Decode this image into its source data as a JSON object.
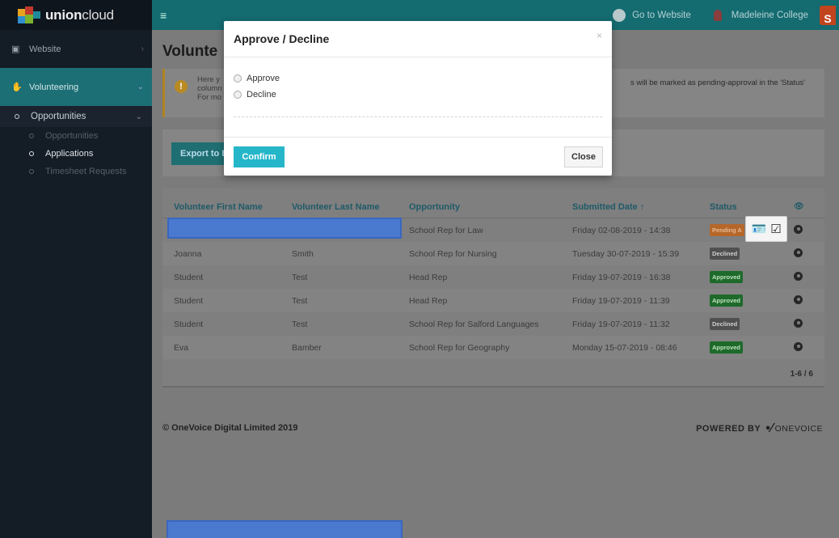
{
  "app": {
    "logo_bold": "union",
    "logo_light": "cloud"
  },
  "topbar": {
    "go_to_website": "Go to Website",
    "user": "Madeleine College",
    "avatar_letter": "S"
  },
  "sidebar": {
    "website": "Website",
    "volunteering": "Volunteering",
    "opportunities_group": "Opportunities",
    "sub_opportunities": "Opportunities",
    "sub_applications": "Applications",
    "sub_timesheet": "Timesheet Requests"
  },
  "main": {
    "title": "Volunte",
    "alert_line1": "Here y",
    "alert_line2": "column",
    "alert_line3": "For mo",
    "alert_right": "s will be marked as pending-approval in the 'Status'",
    "export_label": "Export to I"
  },
  "table": {
    "headers": [
      "Volunteer First Name",
      "Volunteer Last Name",
      "Opportunity",
      "Submitted Date ↑",
      "Status",
      "👁"
    ],
    "rows": [
      {
        "first": "",
        "last": "",
        "opportunity": "School Rep for Law",
        "date": "Friday 02-08-2019 - 14:38",
        "status": "Pending A",
        "status_class": "pending"
      },
      {
        "first": "Joanna",
        "last": "Smith",
        "opportunity": "School Rep for Nursing",
        "date": "Tuesday 30-07-2019 - 15:39",
        "status": "Declined",
        "status_class": "declined"
      },
      {
        "first": "Student",
        "last": "Test",
        "opportunity": "Head Rep",
        "date": "Friday 19-07-2019 - 16:38",
        "status": "Approved",
        "status_class": "approved"
      },
      {
        "first": "Student",
        "last": "Test",
        "opportunity": "Head Rep",
        "date": "Friday 19-07-2019 - 11:39",
        "status": "Approved",
        "status_class": "approved"
      },
      {
        "first": "Student",
        "last": "Test",
        "opportunity": "School Rep for Salford Languages",
        "date": "Friday 19-07-2019 - 11:32",
        "status": "Declined",
        "status_class": "declined"
      },
      {
        "first": "Eva",
        "last": "Bamber",
        "opportunity": "School Rep for Geography",
        "date": "Monday 15-07-2019 - 08:46",
        "status": "Approved",
        "status_class": "approved"
      }
    ],
    "pager": "1-6 / 6"
  },
  "footer": {
    "copyright": "© OneVoice Digital Limited 2019",
    "powered_by": "POWERED BY",
    "brand": "ONEVOICE"
  },
  "modal": {
    "title": "Approve / Decline",
    "close_x": "×",
    "option_approve": "Approve",
    "option_decline": "Decline",
    "confirm_label": "Confirm",
    "close_label": "Close"
  },
  "colors": {
    "accent": "#26b6c9",
    "topbar": "#146b70",
    "sidebar": "#141c26"
  }
}
